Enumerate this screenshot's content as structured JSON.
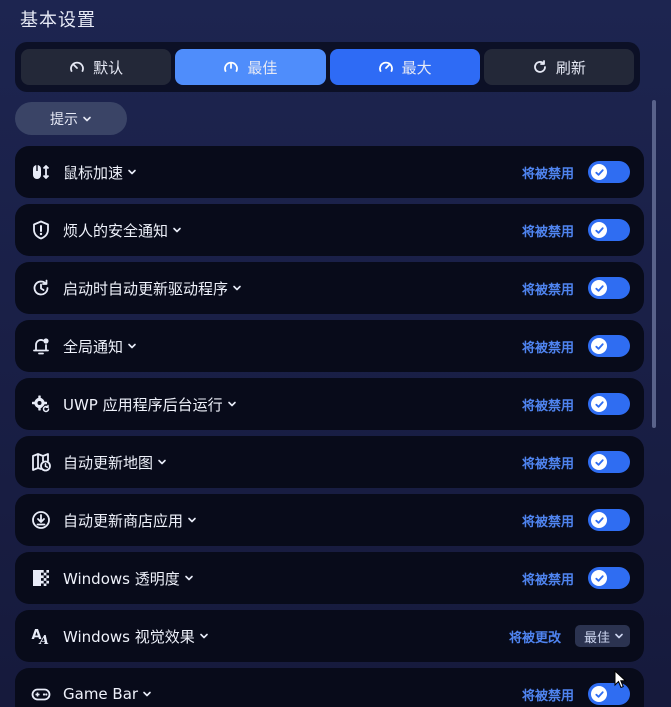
{
  "page": {
    "title": "基本设置"
  },
  "presets": [
    {
      "label": "默认",
      "icon": "gauge-low-icon",
      "state": "normal"
    },
    {
      "label": "最佳",
      "icon": "gauge-mid-icon",
      "state": "active-light"
    },
    {
      "label": "最大",
      "icon": "gauge-high-icon",
      "state": "active-strong"
    },
    {
      "label": "刷新",
      "icon": "refresh-icon",
      "state": "normal"
    }
  ],
  "hint": {
    "label": "提示"
  },
  "settings": [
    {
      "label": "鼠标加速",
      "icon": "mouse-acceleration-icon",
      "status": "将被禁用",
      "control": "toggle",
      "on": true
    },
    {
      "label": "烦人的安全通知",
      "icon": "shield-alert-icon",
      "status": "将被禁用",
      "control": "toggle",
      "on": true
    },
    {
      "label": "启动时自动更新驱动程序",
      "icon": "driver-update-icon",
      "status": "将被禁用",
      "control": "toggle",
      "on": true
    },
    {
      "label": "全局通知",
      "icon": "bell-icon",
      "status": "将被禁用",
      "control": "toggle",
      "on": true
    },
    {
      "label": "UWP 应用程序后台运行",
      "icon": "gear-refresh-icon",
      "status": "将被禁用",
      "control": "toggle",
      "on": true
    },
    {
      "label": "自动更新地图",
      "icon": "map-clock-icon",
      "status": "将被禁用",
      "control": "toggle",
      "on": true
    },
    {
      "label": "自动更新商店应用",
      "icon": "download-circle-icon",
      "status": "将被禁用",
      "control": "toggle",
      "on": true
    },
    {
      "label": "Windows 透明度",
      "icon": "transparency-icon",
      "status": "将被禁用",
      "control": "toggle",
      "on": true
    },
    {
      "label": "Windows 视觉效果",
      "icon": "font-style-icon",
      "status": "将被更改",
      "control": "select",
      "value": "最佳"
    },
    {
      "label": "Game Bar",
      "icon": "gamepad-icon",
      "status": "将被禁用",
      "control": "toggle",
      "on": true
    }
  ],
  "colors": {
    "accent": "#2e6bf5",
    "accent_light": "#4f8dfb",
    "status_text": "#4f84f0",
    "row_bg": "#080b1a"
  }
}
